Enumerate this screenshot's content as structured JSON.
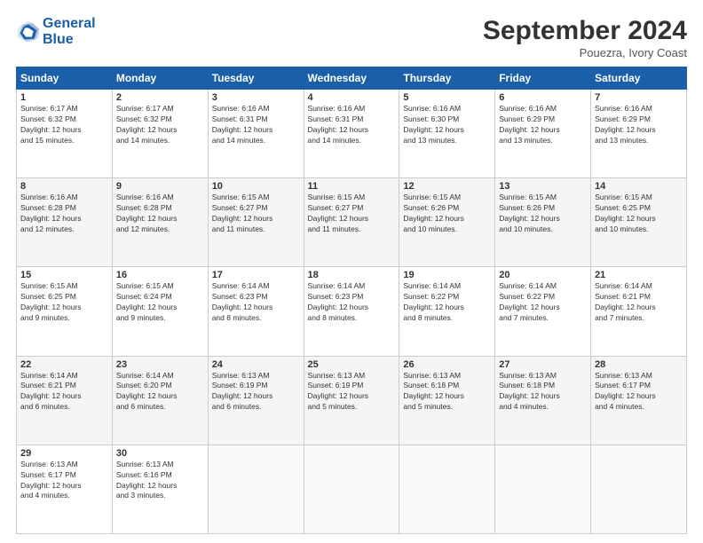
{
  "header": {
    "logo_line1": "General",
    "logo_line2": "Blue",
    "month": "September 2024",
    "location": "Pouezra, Ivory Coast"
  },
  "weekdays": [
    "Sunday",
    "Monday",
    "Tuesday",
    "Wednesday",
    "Thursday",
    "Friday",
    "Saturday"
  ],
  "weeks": [
    [
      {
        "day": "1",
        "lines": [
          "Sunrise: 6:17 AM",
          "Sunset: 6:32 PM",
          "Daylight: 12 hours",
          "and 15 minutes."
        ]
      },
      {
        "day": "2",
        "lines": [
          "Sunrise: 6:17 AM",
          "Sunset: 6:32 PM",
          "Daylight: 12 hours",
          "and 14 minutes."
        ]
      },
      {
        "day": "3",
        "lines": [
          "Sunrise: 6:16 AM",
          "Sunset: 6:31 PM",
          "Daylight: 12 hours",
          "and 14 minutes."
        ]
      },
      {
        "day": "4",
        "lines": [
          "Sunrise: 6:16 AM",
          "Sunset: 6:31 PM",
          "Daylight: 12 hours",
          "and 14 minutes."
        ]
      },
      {
        "day": "5",
        "lines": [
          "Sunrise: 6:16 AM",
          "Sunset: 6:30 PM",
          "Daylight: 12 hours",
          "and 13 minutes."
        ]
      },
      {
        "day": "6",
        "lines": [
          "Sunrise: 6:16 AM",
          "Sunset: 6:29 PM",
          "Daylight: 12 hours",
          "and 13 minutes."
        ]
      },
      {
        "day": "7",
        "lines": [
          "Sunrise: 6:16 AM",
          "Sunset: 6:29 PM",
          "Daylight: 12 hours",
          "and 13 minutes."
        ]
      }
    ],
    [
      {
        "day": "8",
        "lines": [
          "Sunrise: 6:16 AM",
          "Sunset: 6:28 PM",
          "Daylight: 12 hours",
          "and 12 minutes."
        ]
      },
      {
        "day": "9",
        "lines": [
          "Sunrise: 6:16 AM",
          "Sunset: 6:28 PM",
          "Daylight: 12 hours",
          "and 12 minutes."
        ]
      },
      {
        "day": "10",
        "lines": [
          "Sunrise: 6:15 AM",
          "Sunset: 6:27 PM",
          "Daylight: 12 hours",
          "and 11 minutes."
        ]
      },
      {
        "day": "11",
        "lines": [
          "Sunrise: 6:15 AM",
          "Sunset: 6:27 PM",
          "Daylight: 12 hours",
          "and 11 minutes."
        ]
      },
      {
        "day": "12",
        "lines": [
          "Sunrise: 6:15 AM",
          "Sunset: 6:26 PM",
          "Daylight: 12 hours",
          "and 10 minutes."
        ]
      },
      {
        "day": "13",
        "lines": [
          "Sunrise: 6:15 AM",
          "Sunset: 6:26 PM",
          "Daylight: 12 hours",
          "and 10 minutes."
        ]
      },
      {
        "day": "14",
        "lines": [
          "Sunrise: 6:15 AM",
          "Sunset: 6:25 PM",
          "Daylight: 12 hours",
          "and 10 minutes."
        ]
      }
    ],
    [
      {
        "day": "15",
        "lines": [
          "Sunrise: 6:15 AM",
          "Sunset: 6:25 PM",
          "Daylight: 12 hours",
          "and 9 minutes."
        ]
      },
      {
        "day": "16",
        "lines": [
          "Sunrise: 6:15 AM",
          "Sunset: 6:24 PM",
          "Daylight: 12 hours",
          "and 9 minutes."
        ]
      },
      {
        "day": "17",
        "lines": [
          "Sunrise: 6:14 AM",
          "Sunset: 6:23 PM",
          "Daylight: 12 hours",
          "and 8 minutes."
        ]
      },
      {
        "day": "18",
        "lines": [
          "Sunrise: 6:14 AM",
          "Sunset: 6:23 PM",
          "Daylight: 12 hours",
          "and 8 minutes."
        ]
      },
      {
        "day": "19",
        "lines": [
          "Sunrise: 6:14 AM",
          "Sunset: 6:22 PM",
          "Daylight: 12 hours",
          "and 8 minutes."
        ]
      },
      {
        "day": "20",
        "lines": [
          "Sunrise: 6:14 AM",
          "Sunset: 6:22 PM",
          "Daylight: 12 hours",
          "and 7 minutes."
        ]
      },
      {
        "day": "21",
        "lines": [
          "Sunrise: 6:14 AM",
          "Sunset: 6:21 PM",
          "Daylight: 12 hours",
          "and 7 minutes."
        ]
      }
    ],
    [
      {
        "day": "22",
        "lines": [
          "Sunrise: 6:14 AM",
          "Sunset: 6:21 PM",
          "Daylight: 12 hours",
          "and 6 minutes."
        ]
      },
      {
        "day": "23",
        "lines": [
          "Sunrise: 6:14 AM",
          "Sunset: 6:20 PM",
          "Daylight: 12 hours",
          "and 6 minutes."
        ]
      },
      {
        "day": "24",
        "lines": [
          "Sunrise: 6:13 AM",
          "Sunset: 6:19 PM",
          "Daylight: 12 hours",
          "and 6 minutes."
        ]
      },
      {
        "day": "25",
        "lines": [
          "Sunrise: 6:13 AM",
          "Sunset: 6:19 PM",
          "Daylight: 12 hours",
          "and 5 minutes."
        ]
      },
      {
        "day": "26",
        "lines": [
          "Sunrise: 6:13 AM",
          "Sunset: 6:18 PM",
          "Daylight: 12 hours",
          "and 5 minutes."
        ]
      },
      {
        "day": "27",
        "lines": [
          "Sunrise: 6:13 AM",
          "Sunset: 6:18 PM",
          "Daylight: 12 hours",
          "and 4 minutes."
        ]
      },
      {
        "day": "28",
        "lines": [
          "Sunrise: 6:13 AM",
          "Sunset: 6:17 PM",
          "Daylight: 12 hours",
          "and 4 minutes."
        ]
      }
    ],
    [
      {
        "day": "29",
        "lines": [
          "Sunrise: 6:13 AM",
          "Sunset: 6:17 PM",
          "Daylight: 12 hours",
          "and 4 minutes."
        ]
      },
      {
        "day": "30",
        "lines": [
          "Sunrise: 6:13 AM",
          "Sunset: 6:16 PM",
          "Daylight: 12 hours",
          "and 3 minutes."
        ]
      },
      {
        "day": "",
        "lines": []
      },
      {
        "day": "",
        "lines": []
      },
      {
        "day": "",
        "lines": []
      },
      {
        "day": "",
        "lines": []
      },
      {
        "day": "",
        "lines": []
      }
    ]
  ]
}
